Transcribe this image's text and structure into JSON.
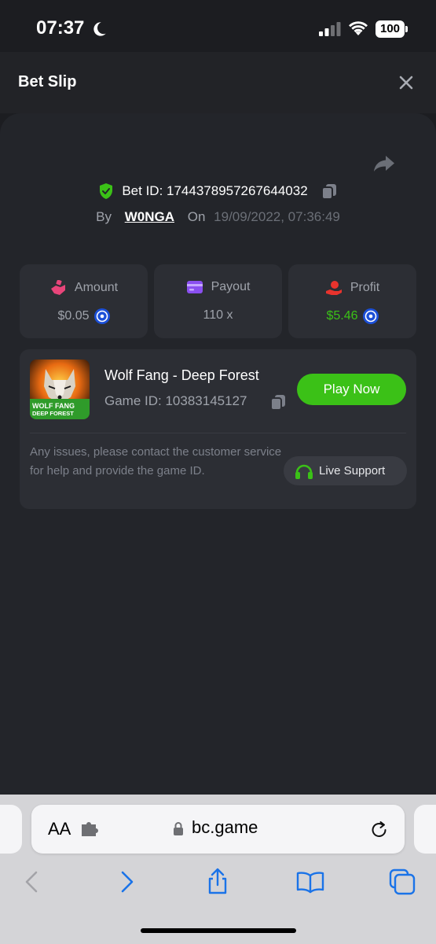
{
  "status_bar": {
    "time": "07:37",
    "battery": "100"
  },
  "header": {
    "title": "Bet Slip"
  },
  "bet": {
    "id_label": "Bet ID: 1744378957267644032",
    "by_label": "By",
    "user": "W0NGA",
    "on_label": "On",
    "date": "19/09/2022, 07:36:49"
  },
  "stats": {
    "amount": {
      "label": "Amount",
      "value": "$0.05"
    },
    "payout": {
      "label": "Payout",
      "value": "110 x"
    },
    "profit": {
      "label": "Profit",
      "value": "$5.46"
    }
  },
  "game": {
    "title": "Wolf Fang - Deep Forest",
    "id_label": "Game ID: 10383145127",
    "thumb_text_1": "WOLF FANG",
    "thumb_text_2": "DEEP FOREST",
    "play_label": "Play Now",
    "support_text": "Any issues, please contact the customer service for help and provide the game ID.",
    "support_label": "Live Support"
  },
  "browser": {
    "aa_label": "AA",
    "url": "bc.game"
  },
  "colors": {
    "accent_green": "#3bc117",
    "amount_pink": "#e8457a",
    "payout_purple": "#8a4ff0",
    "profit_red": "#e8332d"
  },
  "icons": [
    "moon-icon",
    "signal-icon",
    "wifi-icon",
    "close-icon",
    "share-icon",
    "shield-icon",
    "copy-icon",
    "coin-icon",
    "headset-icon",
    "puzzle-icon",
    "lock-icon",
    "reload-icon",
    "back-icon",
    "forward-icon",
    "share-sheet-icon",
    "bookmarks-icon",
    "tabs-icon"
  ]
}
